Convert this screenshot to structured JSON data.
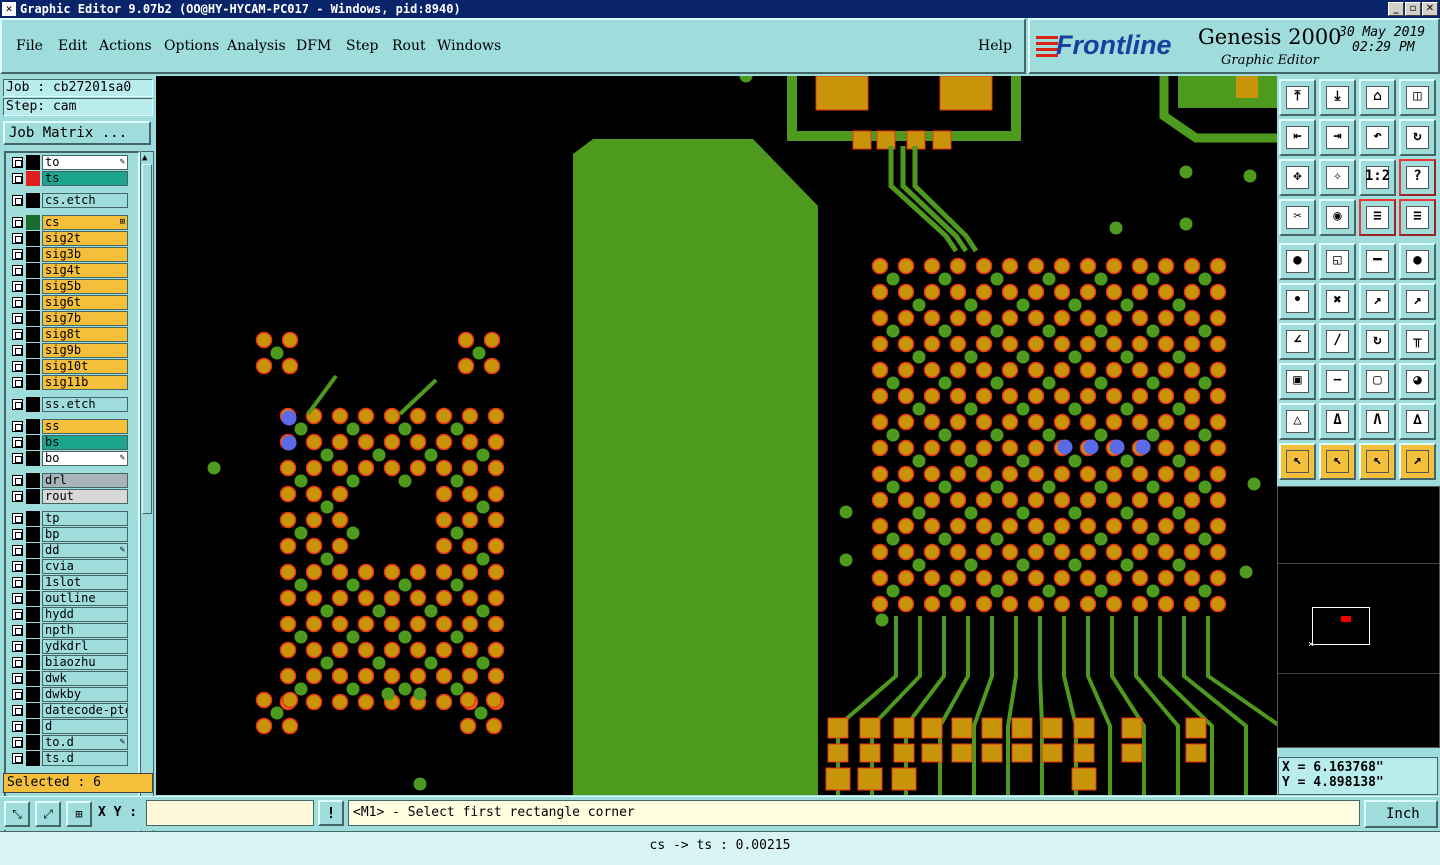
{
  "window": {
    "title": "Graphic Editor 9.07b2 (OO@HY-HYCAM-PC017 - Windows, pid:8940)"
  },
  "menu": [
    "File",
    "Edit",
    "Actions",
    "Options",
    "Analysis",
    "DFM",
    "Step",
    "Rout",
    "Windows"
  ],
  "help_label": "Help",
  "logo": {
    "brand": "Frontline",
    "product": "Genesis 2000",
    "subtitle": "Graphic Editor",
    "date": "30 May 2019",
    "time": "02:29 PM"
  },
  "job": {
    "job_label": "Job : cb27201sa0",
    "step_label": "Step: cam",
    "matrix_button": "Job Matrix ..."
  },
  "layers": [
    {
      "name": "to",
      "color": "#ffffff",
      "swatch": "#000000",
      "mark": "✎"
    },
    {
      "name": "ts",
      "color": "#1aa58c",
      "swatch": "#e02020",
      "mark": ""
    },
    {
      "name": "cs.etch",
      "color": "#9fdcdc",
      "swatch": "#000000",
      "mark": ""
    },
    {
      "name": "cs",
      "color": "#f4c03c",
      "swatch": "#1b6b2e",
      "mark": "⊞"
    },
    {
      "name": "sig2t",
      "color": "#f4c03c",
      "swatch": "#000000",
      "mark": ""
    },
    {
      "name": "sig3b",
      "color": "#f4c03c",
      "swatch": "#000000",
      "mark": ""
    },
    {
      "name": "sig4t",
      "color": "#f4c03c",
      "swatch": "#000000",
      "mark": ""
    },
    {
      "name": "sig5b",
      "color": "#f4c03c",
      "swatch": "#000000",
      "mark": ""
    },
    {
      "name": "sig6t",
      "color": "#f4c03c",
      "swatch": "#000000",
      "mark": ""
    },
    {
      "name": "sig7b",
      "color": "#f4c03c",
      "swatch": "#000000",
      "mark": ""
    },
    {
      "name": "sig8t",
      "color": "#f4c03c",
      "swatch": "#000000",
      "mark": ""
    },
    {
      "name": "sig9b",
      "color": "#f4c03c",
      "swatch": "#000000",
      "mark": ""
    },
    {
      "name": "sig10t",
      "color": "#f4c03c",
      "swatch": "#000000",
      "mark": ""
    },
    {
      "name": "sig11b",
      "color": "#f4c03c",
      "swatch": "#000000",
      "mark": ""
    },
    {
      "name": "ss.etch",
      "color": "#9fdcdc",
      "swatch": "#000000",
      "mark": ""
    },
    {
      "name": "ss",
      "color": "#f4c03c",
      "swatch": "#000000",
      "mark": ""
    },
    {
      "name": "bs",
      "color": "#1aa58c",
      "swatch": "#000000",
      "mark": ""
    },
    {
      "name": "bo",
      "color": "#ffffff",
      "swatch": "#000000",
      "mark": "✎"
    },
    {
      "name": "drl",
      "color": "#a8b4b8",
      "swatch": "#000000",
      "mark": ""
    },
    {
      "name": "rout",
      "color": "#d8d8d8",
      "swatch": "#000000",
      "mark": ""
    },
    {
      "name": "tp",
      "color": "#9fdcdc",
      "swatch": "#000000",
      "mark": ""
    },
    {
      "name": "bp",
      "color": "#9fdcdc",
      "swatch": "#000000",
      "mark": ""
    },
    {
      "name": "dd",
      "color": "#9fdcdc",
      "swatch": "#000000",
      "mark": "✎"
    },
    {
      "name": "cvia",
      "color": "#9fdcdc",
      "swatch": "#000000",
      "mark": ""
    },
    {
      "name": "1slot",
      "color": "#9fdcdc",
      "swatch": "#000000",
      "mark": ""
    },
    {
      "name": "outline",
      "color": "#9fdcdc",
      "swatch": "#000000",
      "mark": ""
    },
    {
      "name": "hydd",
      "color": "#9fdcdc",
      "swatch": "#000000",
      "mark": ""
    },
    {
      "name": "npth",
      "color": "#9fdcdc",
      "swatch": "#000000",
      "mark": ""
    },
    {
      "name": "ydkdrl",
      "color": "#9fdcdc",
      "swatch": "#000000",
      "mark": ""
    },
    {
      "name": "biaozhu",
      "color": "#9fdcdc",
      "swatch": "#000000",
      "mark": ""
    },
    {
      "name": "dwk",
      "color": "#9fdcdc",
      "swatch": "#000000",
      "mark": ""
    },
    {
      "name": "dwkby",
      "color": "#9fdcdc",
      "swatch": "#000000",
      "mark": ""
    },
    {
      "name": "datecode-ptc",
      "color": "#9fdcdc",
      "swatch": "#000000",
      "mark": ""
    },
    {
      "name": "d",
      "color": "#9fdcdc",
      "swatch": "#000000",
      "mark": ""
    },
    {
      "name": "to.d",
      "color": "#9fdcdc",
      "swatch": "#000000",
      "mark": "✎"
    },
    {
      "name": "ts.d",
      "color": "#9fdcdc",
      "swatch": "#000000",
      "mark": ""
    }
  ],
  "selected_label": "Selected : 6",
  "toolbar_icons": [
    "zoom-home-icon",
    "zoom-home-2-icon",
    "home-icon",
    "split-view-icon",
    "pan-left-icon",
    "pan-right-icon",
    "undo-zoom-icon",
    "redraw-icon",
    "fit-all-icon",
    "fit-profile-icon",
    "zoom-1-2-icon",
    "query-icon",
    "tools-icon",
    "snap-icon",
    "layer-colors-icon",
    "layer-colors-2-icon",
    "feature-info-icon",
    "select-region-icon",
    "measure-ruler-icon",
    "pad-icon",
    "net-icon",
    "cross-icon",
    "line-end-icon",
    "line-end-2-icon",
    "angle-icon",
    "slope-icon",
    "arc-icon",
    "mirror-icon",
    "clip-icon",
    "minus-icon",
    "resize-icon",
    "shapes-icon",
    "triangle-icon",
    "a-frame-icon",
    "arch-icon",
    "mountain-icon",
    "pointer-icon",
    "pointer-select-icon",
    "pointer-box-icon",
    "route-icon"
  ],
  "toolbar_glyphs": [
    "⤒",
    "⤓",
    "⌂",
    "◫",
    "⇤",
    "⇥",
    "↶",
    "↻",
    "✥",
    "✧",
    "1:2",
    "?",
    "✂",
    "◉",
    "≡",
    "≡",
    "●",
    "◱",
    "━",
    "●",
    "•",
    "✖",
    "↗",
    "↗",
    "∠",
    "∕",
    "↻",
    "╥",
    "▣",
    "−",
    "▢",
    "◕",
    "△",
    "Δ",
    "Ʌ",
    "∆",
    "↖",
    "↖",
    "↖",
    "↗"
  ],
  "coords": {
    "x": "X = 6.163768\"",
    "y": "Y = 4.898138\""
  },
  "xy_label": "X Y :",
  "xy_value": "",
  "prompt": "<M1> - Select first rectangle corner",
  "unit": "Inch",
  "status": "cs -> ts : 0.00215",
  "colors": {
    "copper": "#4e9a1e",
    "pad": "#c8940a",
    "pad_outline": "#e8321a",
    "highlight": "#5a6ae8"
  }
}
